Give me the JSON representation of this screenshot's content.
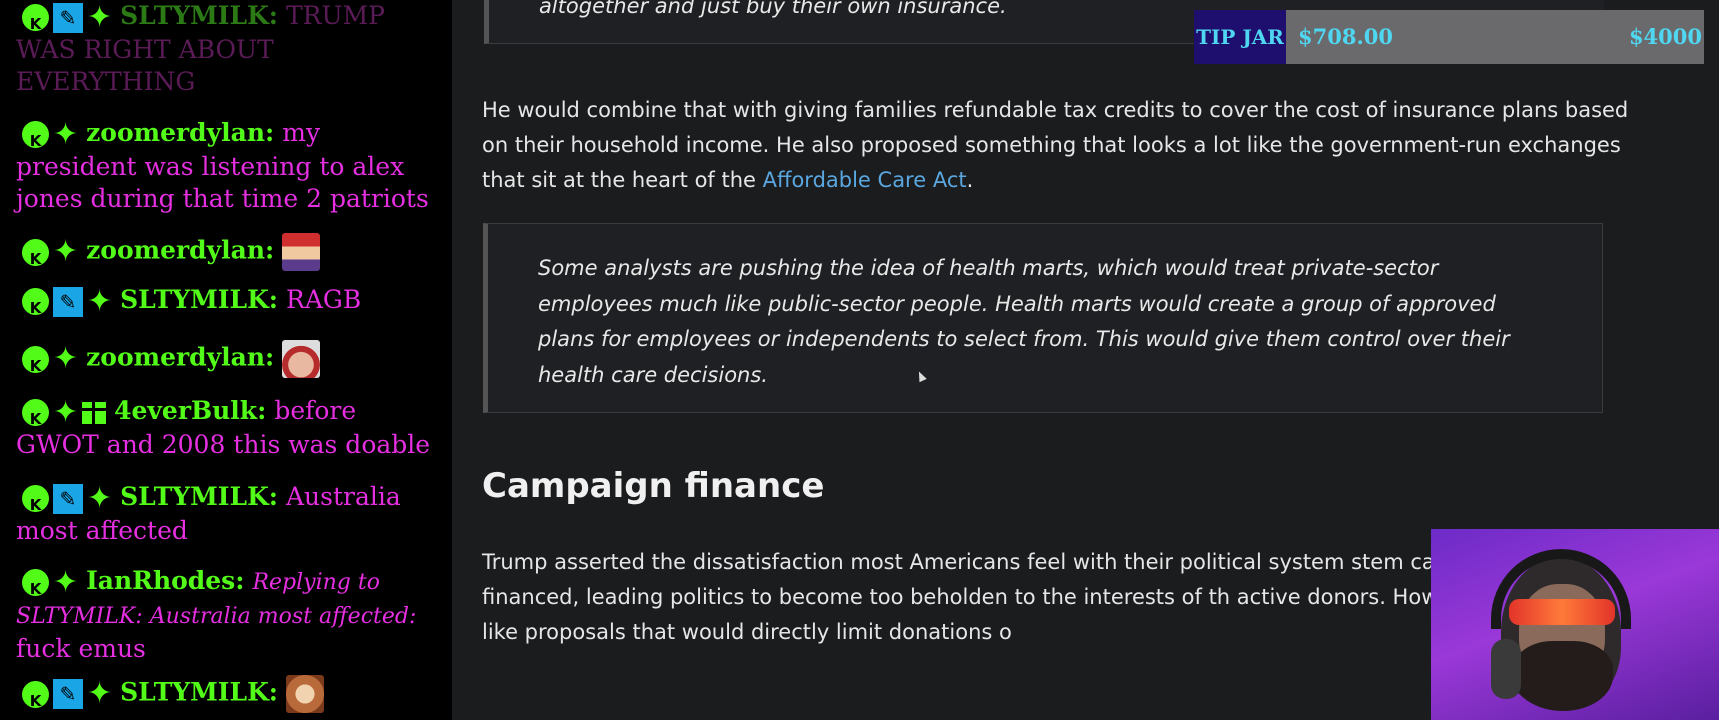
{
  "chat": {
    "messages": [
      {
        "user": "SLTYMILK:",
        "text": "TRUMP WAS RIGHT ABOUT EVERYTHING"
      },
      {
        "user": "zoomerdylan:",
        "text": "my president was listening to alex jones during that time 2 patriots"
      },
      {
        "user": "zoomerdylan:",
        "text": ""
      },
      {
        "user": "SLTYMILK:",
        "text": "RAGB"
      },
      {
        "user": "zoomerdylan:",
        "text": ""
      },
      {
        "user": "4everBulk:",
        "text": "before GWOT and 2008 this was doable"
      },
      {
        "user": "SLTYMILK:",
        "text": "Australia most affected"
      },
      {
        "user": "IanRhodes:",
        "text": "Replying to SLTYMILK: Australia most affected:",
        "text2": "fuck emus"
      },
      {
        "user": "SLTYMILK:",
        "text": ""
      }
    ]
  },
  "article": {
    "prev_quote_tail": "altogether and just buy their own insurance.",
    "para1": "He would combine that with giving families refundable tax credits to cover the cost of insurance plans based on their household income. He also proposed something that looks a lot like the government-run exchanges that sit at the heart of the ",
    "para1_link": "Affordable Care Act",
    "para1_end": ".",
    "blockquote": "Some analysts are pushing the idea of health marts, which would treat private-sector employees much like public-sector people. Health marts would create a group of approved plans for employees or independents to select from. This would give them control over their health care decisions.",
    "heading": "Campaign finance",
    "para2": "Trump asserted the dissatisfaction most Americans feel with their political system stem campaigns are financed, leading politics to become too beholden to the interests of th active donors. However, he doesn’t like proposals that would directly limit donations o"
  },
  "tipjar": {
    "label": "TIP JAR",
    "current": "$708.00",
    "goal": "$4000",
    "fraction": 0.177
  }
}
